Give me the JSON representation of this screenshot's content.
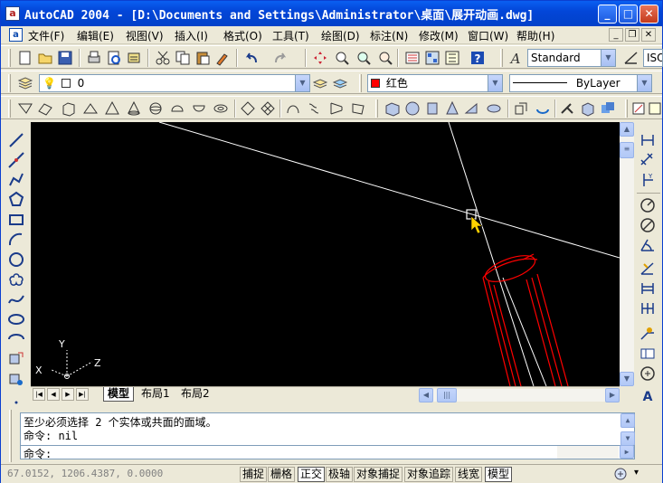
{
  "window": {
    "title": "AutoCAD 2004 - [D:\\Documents and Settings\\Administrator\\桌面\\展开动画.dwg]",
    "app_icon": "autocad-icon",
    "min_label": "_",
    "max_label": "□",
    "close_label": "✕"
  },
  "menubar": {
    "items": [
      "文件(F)",
      "编辑(E)",
      "视图(V)",
      "插入(I)",
      "格式(O)",
      "工具(T)",
      "绘图(D)",
      "标注(N)",
      "修改(M)",
      "窗口(W)",
      "帮助(H)"
    ],
    "doc_min": "_",
    "doc_restore": "❐",
    "doc_close": "✕"
  },
  "standard_toolbar": {
    "text_style": "Standard",
    "dim_style": "ISO"
  },
  "layers_toolbar": {
    "layer": "0",
    "color": "红色",
    "linetype": "ByLayer",
    "color_hex": "#ff0000"
  },
  "model_tabs": {
    "tabs": [
      "模型",
      "布局1",
      "布局2"
    ],
    "active": "模型"
  },
  "ucs": {
    "x": "X",
    "y": "Y",
    "z": "Z"
  },
  "command": {
    "history": [
      "至少必须选择 2 个实体或共面的面域。",
      "命令: nil"
    ],
    "prompt": "命令:"
  },
  "status": {
    "coords": "67.0152,    1206.4387, 0.0000",
    "buttons": [
      {
        "label": "捕捉",
        "on": false
      },
      {
        "label": "栅格",
        "on": false
      },
      {
        "label": "正交",
        "on": true
      },
      {
        "label": "极轴",
        "on": false
      },
      {
        "label": "对象捕捉",
        "on": false
      },
      {
        "label": "对象追踪",
        "on": false
      },
      {
        "label": "线宽",
        "on": false
      },
      {
        "label": "模型",
        "on": true
      }
    ]
  },
  "colors": {
    "title_bar": "#0346d8",
    "canvas": "#000000",
    "crosshair": "#ffffff",
    "object_red": "#ff0000",
    "cursor_arrow": "#ffd200"
  }
}
